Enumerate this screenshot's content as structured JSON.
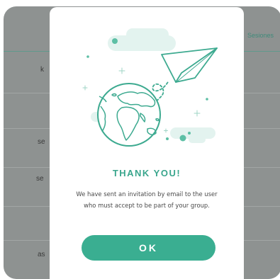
{
  "background": {
    "column_header": "Sesiones",
    "row_fragments": [
      "k",
      "se",
      "se",
      "as"
    ]
  },
  "modal": {
    "title": "THANK YOU!",
    "message": "We have sent an invitation by email to the user who must accept to be part of your group.",
    "ok_label": "OK"
  },
  "colors": {
    "accent": "#3aae91",
    "title": "#3aa68d",
    "illustration_stroke": "#3daa90",
    "illustration_fill": "#e3f3ef",
    "overlay": "#8e9291"
  },
  "icons": {
    "illustration": "globe-paper-plane-illustration"
  }
}
